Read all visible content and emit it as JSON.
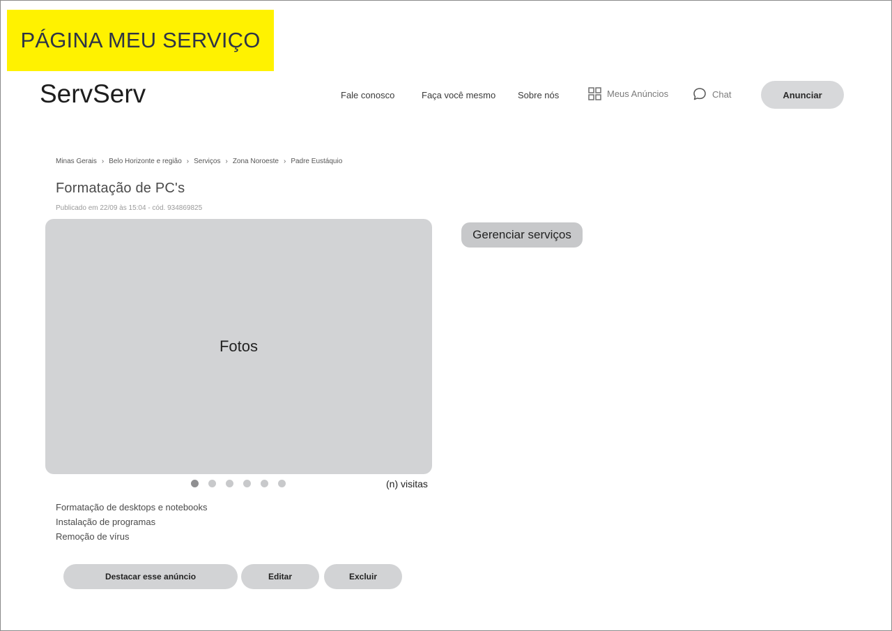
{
  "page_label": "PÁGINA MEU SERVIÇO",
  "header": {
    "logo": "ServServ",
    "nav": {
      "fale_conosco": "Fale conosco",
      "faca_voce_mesmo": "Faça você mesmo",
      "sobre_nos": "Sobre nós",
      "meus_anuncios": "Meus Anúncios",
      "chat": "Chat"
    },
    "anunciar_label": "Anunciar"
  },
  "breadcrumb": [
    "Minas Gerais",
    "Belo Horizonte e região",
    "Serviços",
    "Zona Noroeste",
    "Padre Eustáquio"
  ],
  "listing": {
    "title": "Formatação de PC's",
    "meta": "Publicado em 22/09 às 15:04 - cód. 934869825",
    "photos_label": "Fotos",
    "visits": "(n) visitas",
    "carousel": {
      "count": 6,
      "active_index": 0
    },
    "services": [
      "Formatação de desktops e notebooks",
      "Instalação de programas",
      "Remoção de vírus"
    ]
  },
  "manage_label": "Gerenciar serviços",
  "actions": {
    "destacar": "Destacar esse anúncio",
    "editar": "Editar",
    "excluir": "Excluir"
  },
  "colors": {
    "label_bg": "#fff200",
    "button_bg": "#d2d3d5",
    "photo_bg": "#d2d3d5"
  },
  "icons": {
    "meus_anuncios": "grid-icon",
    "chat": "chat-bubble-icon",
    "breadcrumb_separator": "chevron-right-icon"
  }
}
